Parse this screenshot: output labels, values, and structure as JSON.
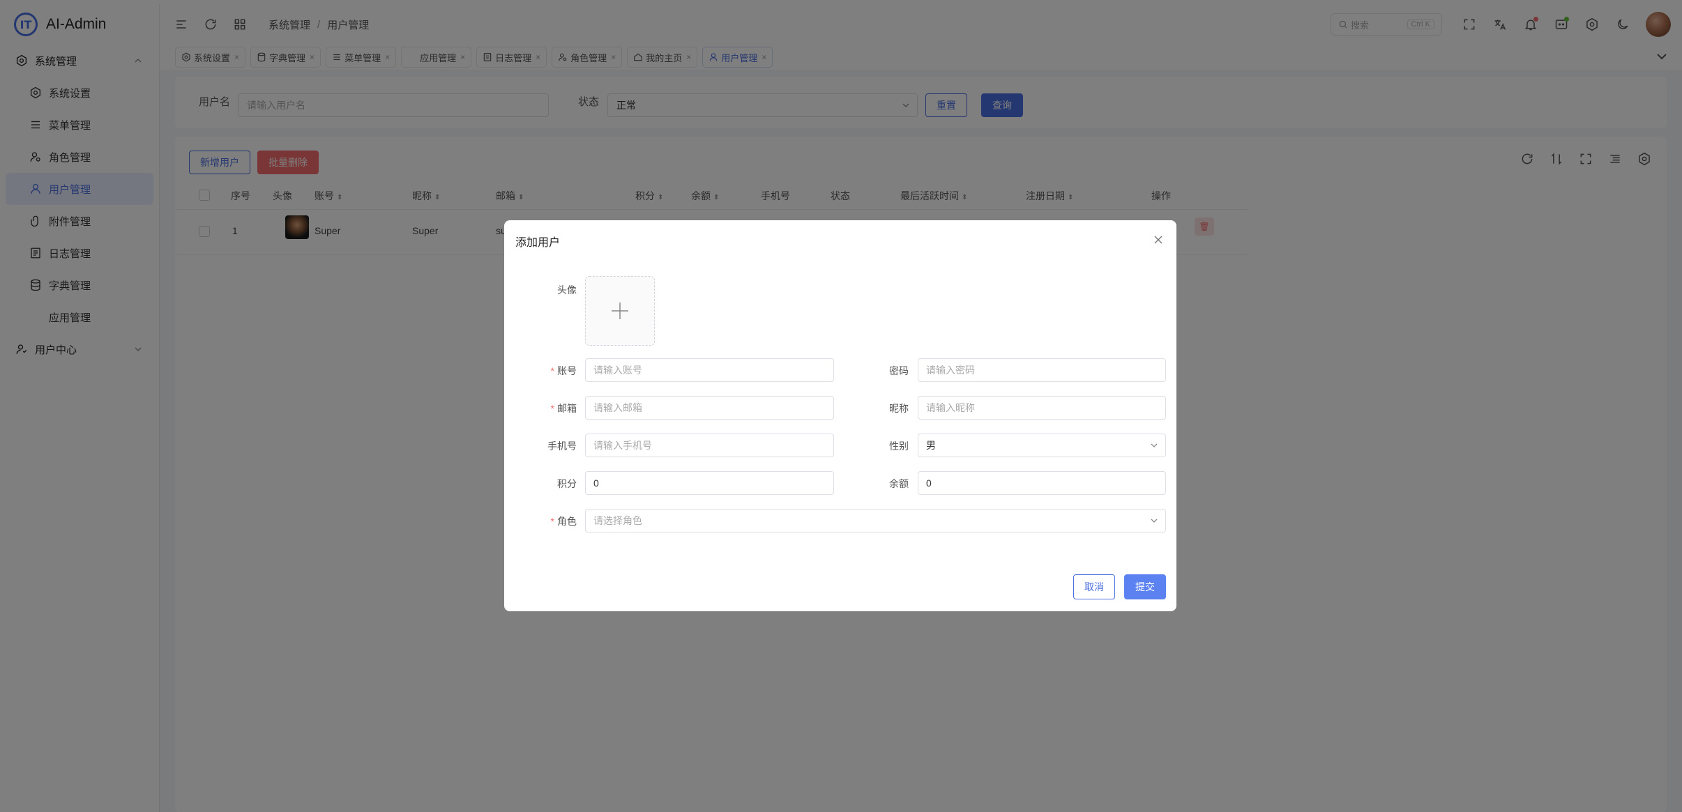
{
  "app": {
    "name": "AI-Admin",
    "logo_letters": "IT"
  },
  "sidebar": {
    "groups": [
      {
        "label": "系统管理",
        "expanded": true
      },
      {
        "label": "用户中心",
        "expanded": false
      }
    ],
    "items": [
      {
        "label": "系统设置",
        "icon": "gear-icon"
      },
      {
        "label": "菜单管理",
        "icon": "menu-icon"
      },
      {
        "label": "角色管理",
        "icon": "role-icon"
      },
      {
        "label": "用户管理",
        "icon": "user-icon",
        "active": true
      },
      {
        "label": "附件管理",
        "icon": "attachment-icon"
      },
      {
        "label": "日志管理",
        "icon": "log-icon"
      },
      {
        "label": "字典管理",
        "icon": "database-icon"
      },
      {
        "label": "应用管理",
        "icon": ""
      }
    ]
  },
  "header": {
    "breadcrumb": [
      "系统管理",
      "用户管理"
    ],
    "breadcrumb_sep": "/",
    "search_placeholder": "搜索",
    "search_shortcut": "Ctrl K"
  },
  "tabs": [
    {
      "label": "系统设置",
      "icon": "gear-icon"
    },
    {
      "label": "字典管理",
      "icon": "database-icon"
    },
    {
      "label": "菜单管理",
      "icon": "menu-icon"
    },
    {
      "label": "应用管理",
      "icon": ""
    },
    {
      "label": "日志管理",
      "icon": "log-icon"
    },
    {
      "label": "角色管理",
      "icon": "role-icon"
    },
    {
      "label": "我的主页",
      "icon": "home-icon"
    },
    {
      "label": "用户管理",
      "icon": "user-icon",
      "active": true
    }
  ],
  "tab_close": "×",
  "filter": {
    "username_label": "用户名",
    "username_placeholder": "请输入用户名",
    "status_label": "状态",
    "status_value": "正常",
    "reset_label": "重置",
    "query_label": "查询"
  },
  "table": {
    "add_label": "新增用户",
    "batch_delete_label": "批量删除",
    "columns": [
      "序号",
      "头像",
      "账号",
      "昵称",
      "邮箱",
      "积分",
      "余额",
      "手机号",
      "状态",
      "最后活跃时间",
      "注册日期",
      "操作"
    ],
    "rows": [
      {
        "index": "1",
        "account": "Super",
        "nickname": "Super",
        "email_fragment": "su"
      }
    ]
  },
  "dialog": {
    "title": "添加用户",
    "avatar_label": "头像",
    "account_label": "账号",
    "account_placeholder": "请输入账号",
    "password_label": "密码",
    "password_placeholder": "请输入密码",
    "email_label": "邮箱",
    "email_placeholder": "请输入邮箱",
    "nickname_label": "昵称",
    "nickname_placeholder": "请输入昵称",
    "phone_label": "手机号",
    "phone_placeholder": "请输入手机号",
    "gender_label": "性别",
    "gender_value": "男",
    "points_label": "积分",
    "points_value": "0",
    "balance_label": "余额",
    "balance_value": "0",
    "role_label": "角色",
    "role_placeholder": "请选择角色",
    "required_mark": "*",
    "cancel_label": "取消",
    "submit_label": "提交"
  },
  "colors": {
    "accent": "#4a6ee0",
    "danger": "#f56c6c",
    "overlay": "rgba(0,0,0,0.5)"
  }
}
